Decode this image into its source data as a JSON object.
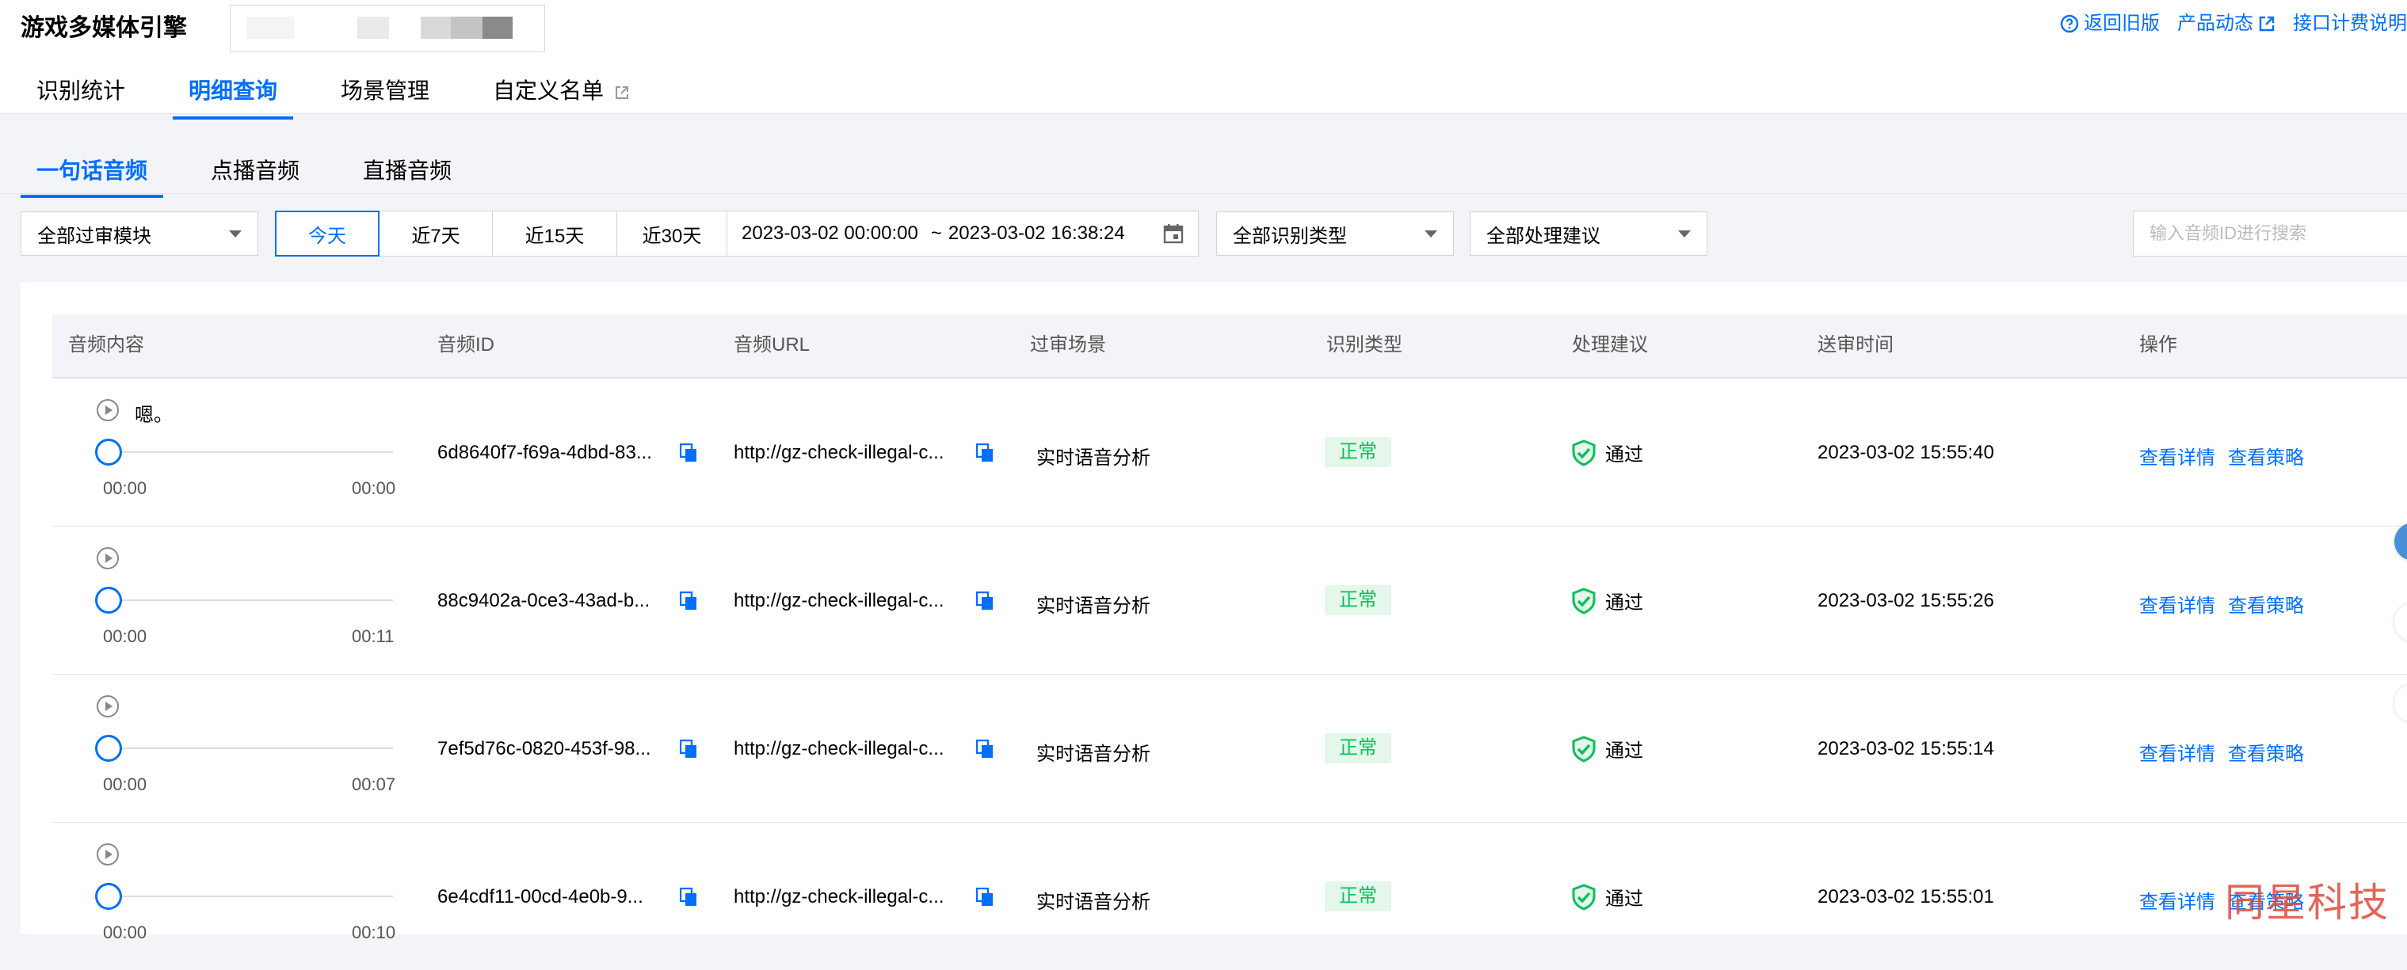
{
  "header": {
    "app_title": "游戏多媒体引擎",
    "links": [
      {
        "label": "返回旧版",
        "icon": "help-circle-icon"
      },
      {
        "label": "产品动态",
        "icon": "external-link-icon"
      },
      {
        "label": "接口计费说明",
        "icon": ""
      }
    ]
  },
  "tabs": [
    "识别统计",
    "明细查询",
    "场景管理",
    "自定义名单"
  ],
  "active_tab": "明细查询",
  "subtabs": [
    "一句话音频",
    "点播音频",
    "直播音频"
  ],
  "active_subtab": "一句话音频",
  "filters": {
    "module_select": "全部过审模块",
    "ranges": [
      "今天",
      "近7天",
      "近15天",
      "近30天"
    ],
    "active_range": "今天",
    "date_start": "2023-03-02 00:00:00",
    "date_sep": "~",
    "date_end": "2023-03-02 16:38:24",
    "type_select": "全部识别类型",
    "suggestion_select": "全部处理建议",
    "search_placeholder": "输入音频ID进行搜索"
  },
  "table": {
    "columns": [
      "音频内容",
      "音频ID",
      "音频URL",
      "过审场景",
      "识别类型",
      "处理建议",
      "送审时间",
      "操作"
    ],
    "rows": [
      {
        "text": "嗯。",
        "start": "00:00",
        "end": "00:00",
        "id": "6d8640f7-f69a-4dbd-83...",
        "url": "http://gz-check-illegal-c...",
        "scene": "实时语音分析",
        "type": "正常",
        "suggestion": "通过",
        "time": "2023-03-02 15:55:40",
        "op1": "查看详情",
        "op2": "查看策略"
      },
      {
        "text": "",
        "start": "00:00",
        "end": "00:11",
        "id": "88c9402a-0ce3-43ad-b...",
        "url": "http://gz-check-illegal-c...",
        "scene": "实时语音分析",
        "type": "正常",
        "suggestion": "通过",
        "time": "2023-03-02 15:55:26",
        "op1": "查看详情",
        "op2": "查看策略"
      },
      {
        "text": "",
        "start": "00:00",
        "end": "00:07",
        "id": "7ef5d76c-0820-453f-98...",
        "url": "http://gz-check-illegal-c...",
        "scene": "实时语音分析",
        "type": "正常",
        "suggestion": "通过",
        "time": "2023-03-02 15:55:14",
        "op1": "查看详情",
        "op2": "查看策略"
      },
      {
        "text": "",
        "start": "00:00",
        "end": "00:10",
        "id": "6e4cdf11-00cd-4e0b-9...",
        "url": "http://gz-check-illegal-c...",
        "scene": "实时语音分析",
        "type": "正常",
        "suggestion": "通过",
        "time": "2023-03-02 15:55:01",
        "op1": "查看详情",
        "op2": "查看策略"
      }
    ]
  },
  "watermark": "同星科技",
  "colors": {
    "primary": "#006eff",
    "success": "#0abf5b",
    "tag_bg": "#e4f7ea"
  }
}
